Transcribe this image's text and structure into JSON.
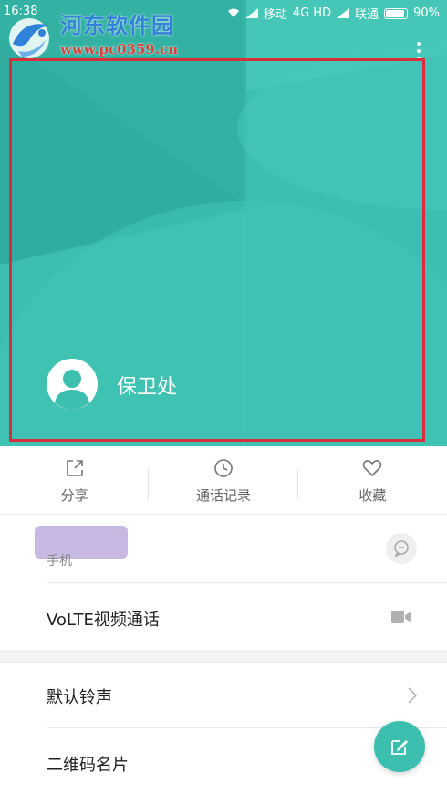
{
  "statusbar": {
    "time": "16:38",
    "carrier1": "移动",
    "network": "4G HD",
    "carrier2": "联通",
    "battery": "90%"
  },
  "watermark": {
    "title": "河东软件园",
    "url": "www.pc0359.cn"
  },
  "header": {
    "background_color": "#3dbfb0",
    "more_icon": "more-vertical-icon"
  },
  "contact": {
    "name": "保卫处",
    "avatar_icon": "person-icon"
  },
  "actions": [
    {
      "label": "分享",
      "icon": "share-icon"
    },
    {
      "label": "通话记录",
      "icon": "clock-icon"
    },
    {
      "label": "收藏",
      "icon": "heart-icon"
    }
  ],
  "phone": {
    "label": "手机",
    "message_icon": "message-icon"
  },
  "volte": {
    "label": "VoLTE视频通话",
    "icon": "video-camera-icon"
  },
  "settings": [
    {
      "label": "默认铃声",
      "icon": "chevron-right-icon"
    },
    {
      "label": "二维码名片"
    }
  ],
  "fab": {
    "icon": "edit-icon",
    "color": "#3dbfb0"
  },
  "highlight_color": "#d62e3a"
}
